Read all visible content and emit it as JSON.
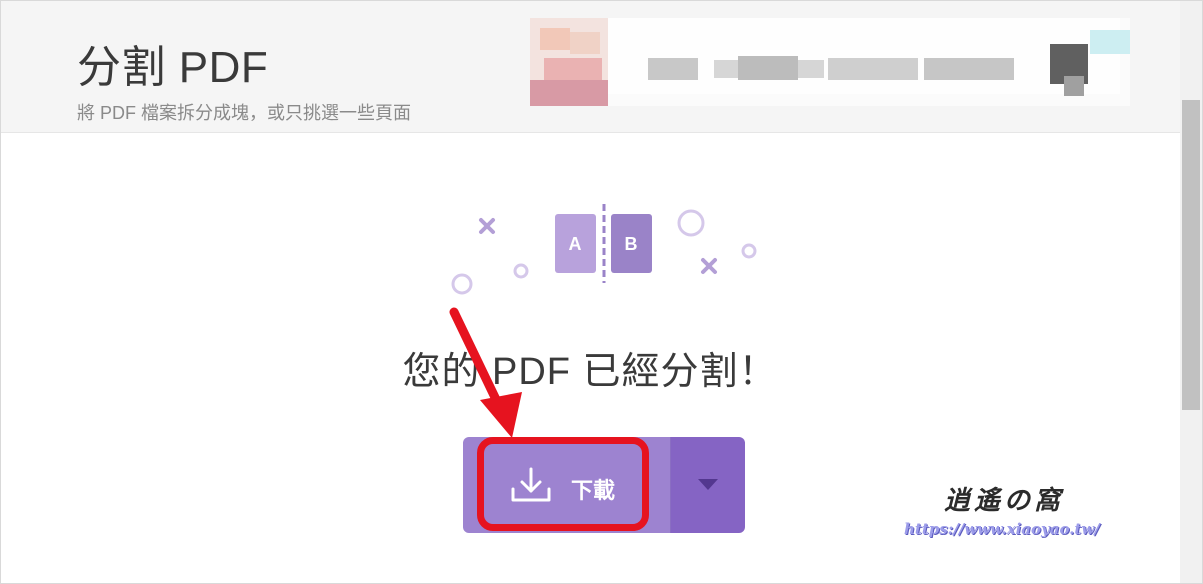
{
  "header": {
    "title": "分割 PDF",
    "subtitle": "將 PDF 檔案拆分成塊，或只挑選一些頁面"
  },
  "illustration": {
    "page_a_label": "A",
    "page_b_label": "B"
  },
  "result": {
    "message": "您的 PDF 已經分割！"
  },
  "download": {
    "label": "下載",
    "icon": "download-icon",
    "dropdown_icon": "caret-down-icon"
  },
  "watermark": {
    "logo_text": "逍遙の窩",
    "url": "https://www.xiaoyao.tw/"
  },
  "colors": {
    "button_main": "#9d83d0",
    "button_dropdown": "#8564c4",
    "highlight": "#e6131f",
    "accent_purple": "#b8a2dc"
  }
}
